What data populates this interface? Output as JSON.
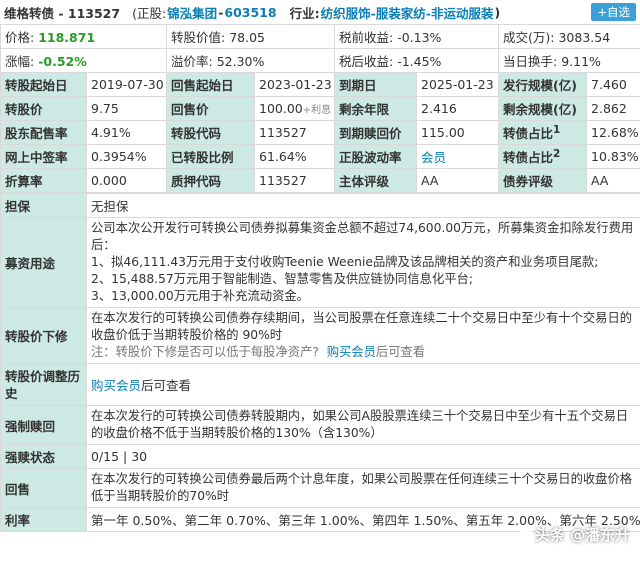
{
  "header": {
    "bond_name": "维格转债 - 113527",
    "stock_prefix": "(正股:",
    "stock_name": "锦泓集团",
    "stock_dash": " - ",
    "stock_code": "603518",
    "industry_label": "行业:",
    "industry_value": "纺织服饰-服装家纺-非运动服装",
    "industry_close": ")",
    "self_select": "+自选"
  },
  "quote_rows": [
    [
      {
        "k": "价格:",
        "v": "118.871",
        "g": true
      },
      {
        "k": "转股价值:",
        "v": "78.05"
      },
      {
        "k": "税前收益:",
        "v": "-0.13%"
      },
      {
        "k": "成交(万):",
        "v": "3083.54"
      }
    ],
    [
      {
        "k": "涨幅:",
        "v": "-0.52%",
        "g": true
      },
      {
        "k": "溢价率:",
        "v": "52.30%"
      },
      {
        "k": "税后收益:",
        "v": "-1.45%"
      },
      {
        "k": "当日换手:",
        "v": "9.11%"
      }
    ]
  ],
  "grid_rows": [
    [
      {
        "k": "转股起始日",
        "v": "2019-07-30"
      },
      {
        "k": "回售起始日",
        "v": "2023-01-23"
      },
      {
        "k": "到期日",
        "v": "2025-01-23"
      },
      {
        "k": "发行规模(亿)",
        "v": "7.460"
      }
    ],
    [
      {
        "k": "转股价",
        "v": "9.75"
      },
      {
        "k": "回售价",
        "v": "100.00",
        "x": "+利息"
      },
      {
        "k": "剩余年限",
        "v": "2.416"
      },
      {
        "k": "剩余规模(亿)",
        "v": "2.862"
      }
    ],
    [
      {
        "k": "股东配售率",
        "v": "4.91%"
      },
      {
        "k": "转股代码",
        "v": "113527"
      },
      {
        "k": "到期赎回价",
        "v": "115.00"
      },
      {
        "k": "转债占比",
        "sup": "1",
        "v": "12.68%",
        "right": true
      }
    ],
    [
      {
        "k": "网上中签率",
        "v": "0.3954%"
      },
      {
        "k": "已转股比例",
        "v": "61.64%"
      },
      {
        "k": "正股波动率",
        "v": "会员",
        "link": true
      },
      {
        "k": "转债占比",
        "sup": "2",
        "v": "10.83%",
        "right": true
      }
    ],
    [
      {
        "k": "折算率",
        "v": "0.000"
      },
      {
        "k": "质押代码",
        "v": "113527"
      },
      {
        "k": "主体评级",
        "v": "AA"
      },
      {
        "k": "债券评级",
        "v": "AA"
      }
    ]
  ],
  "guarantee": {
    "label": "担保",
    "value": "无担保"
  },
  "fund_use": {
    "label": "募资用途",
    "lines": [
      "公司本次公开发行可转换公司债券拟募集资金总额不超过74,600.00万元，所募集资金扣除发行费用后：",
      "1、拟46,111.43万元用于支付收购Teenie Weenie品牌及该品牌相关的资产和业务项目尾款;",
      "2、15,488.57万元用于智能制造、智慧零售及供应链协同信息化平台;",
      "3、13,000.00万元用于补充流动资金。"
    ]
  },
  "down_revision": {
    "label": "转股价下修",
    "text": "在本次发行的可转换公司债券存续期间，当公司股票在任意连续二十个交易日中至少有十个交易日的收盘价低于当期转股价格的 90%时",
    "note": "注：转股价下修是否可以低于每股净资产?",
    "note_link": "购买会员",
    "note_tail": "后可查看"
  },
  "history": {
    "label": "转股价调整历史",
    "link": "购买会员",
    "tail": "后可查看"
  },
  "forced_call": {
    "label": "强制赎回",
    "text": "在本次发行的可转换公司债券转股期内，如果公司A股股票连续三十个交易日中至少有十五个交易日的收盘价格不低于当期转股价格的130%（含130%）"
  },
  "call_status": {
    "label": "强赎状态",
    "value": "0/15 | 30"
  },
  "putback": {
    "label": "回售",
    "text": "在本次发行的可转换公司债券最后两个计息年度，如果公司股票在任何连续三十个交易日的收盘价格低于当期转股价的70%时"
  },
  "rate": {
    "label": "利率",
    "text": "第一年 0.50%、第二年 0.70%、第三年 1.00%、第四年 1.50%、第五年 2.00%、第六年 2.50%"
  },
  "watermark": "头条 @潘东升",
  "colors": {
    "label_bg": "#cde9e4",
    "green": "#2a9a2a",
    "link": "#0a7fb5",
    "button": "#3b9fd8"
  }
}
